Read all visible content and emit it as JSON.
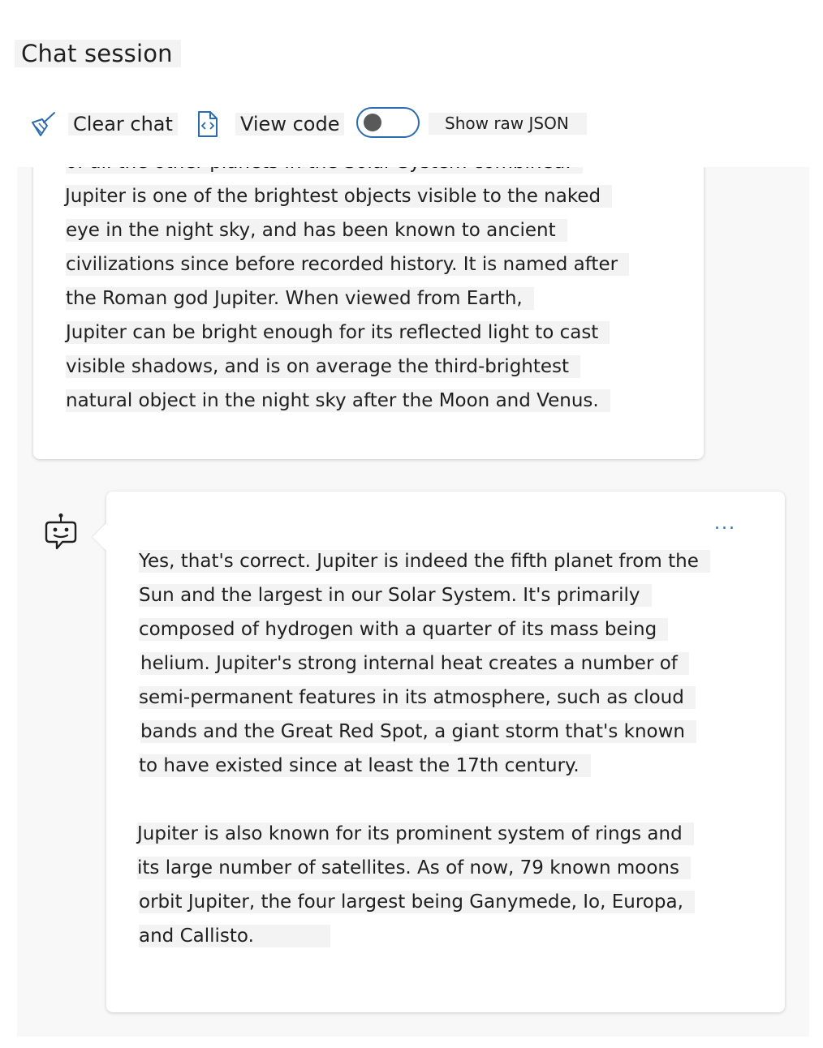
{
  "header": {
    "title": "Chat session"
  },
  "toolbar": {
    "clear_label": "Clear chat",
    "view_code_label": "View code",
    "toggle_label": "Show raw JSON",
    "toggle_on": false
  },
  "colors": {
    "accent": "#2b6cb0",
    "text_highlight": "#f3f3f3",
    "chat_background": "#f8f8f8"
  },
  "messages": [
    {
      "role": "user",
      "lines": [
        "of all the other planets in the Solar System combined.",
        "Jupiter is one of the brightest objects visible to the naked",
        "eye in the night sky, and has been known to ancient",
        "civilizations since before recorded history. It is named after",
        "the Roman god Jupiter. When viewed from Earth,",
        "Jupiter can be bright enough for its reflected light to cast",
        "visible shadows, and is on average the third-brightest",
        "natural object in the night sky after the Moon and Venus."
      ]
    },
    {
      "role": "assistant",
      "more_label": "...",
      "paragraphs": [
        [
          "Yes, that's correct. Jupiter is indeed the fifth planet from the",
          "Sun and the largest in our Solar System. It's primarily",
          "composed of hydrogen with a quarter of its mass being",
          "helium. Jupiter's strong internal heat creates a number of",
          "semi-permanent features in its atmosphere, such as cloud",
          "bands and the Great Red Spot, a giant storm that's known",
          "to have existed since at least the 17th century."
        ],
        [
          "Jupiter is also known for its prominent system of rings and",
          "its large number of satellites. As of now, 79 known moons",
          "orbit Jupiter, the four largest being Ganymede, Io, Europa,",
          "and Callisto."
        ]
      ]
    }
  ]
}
